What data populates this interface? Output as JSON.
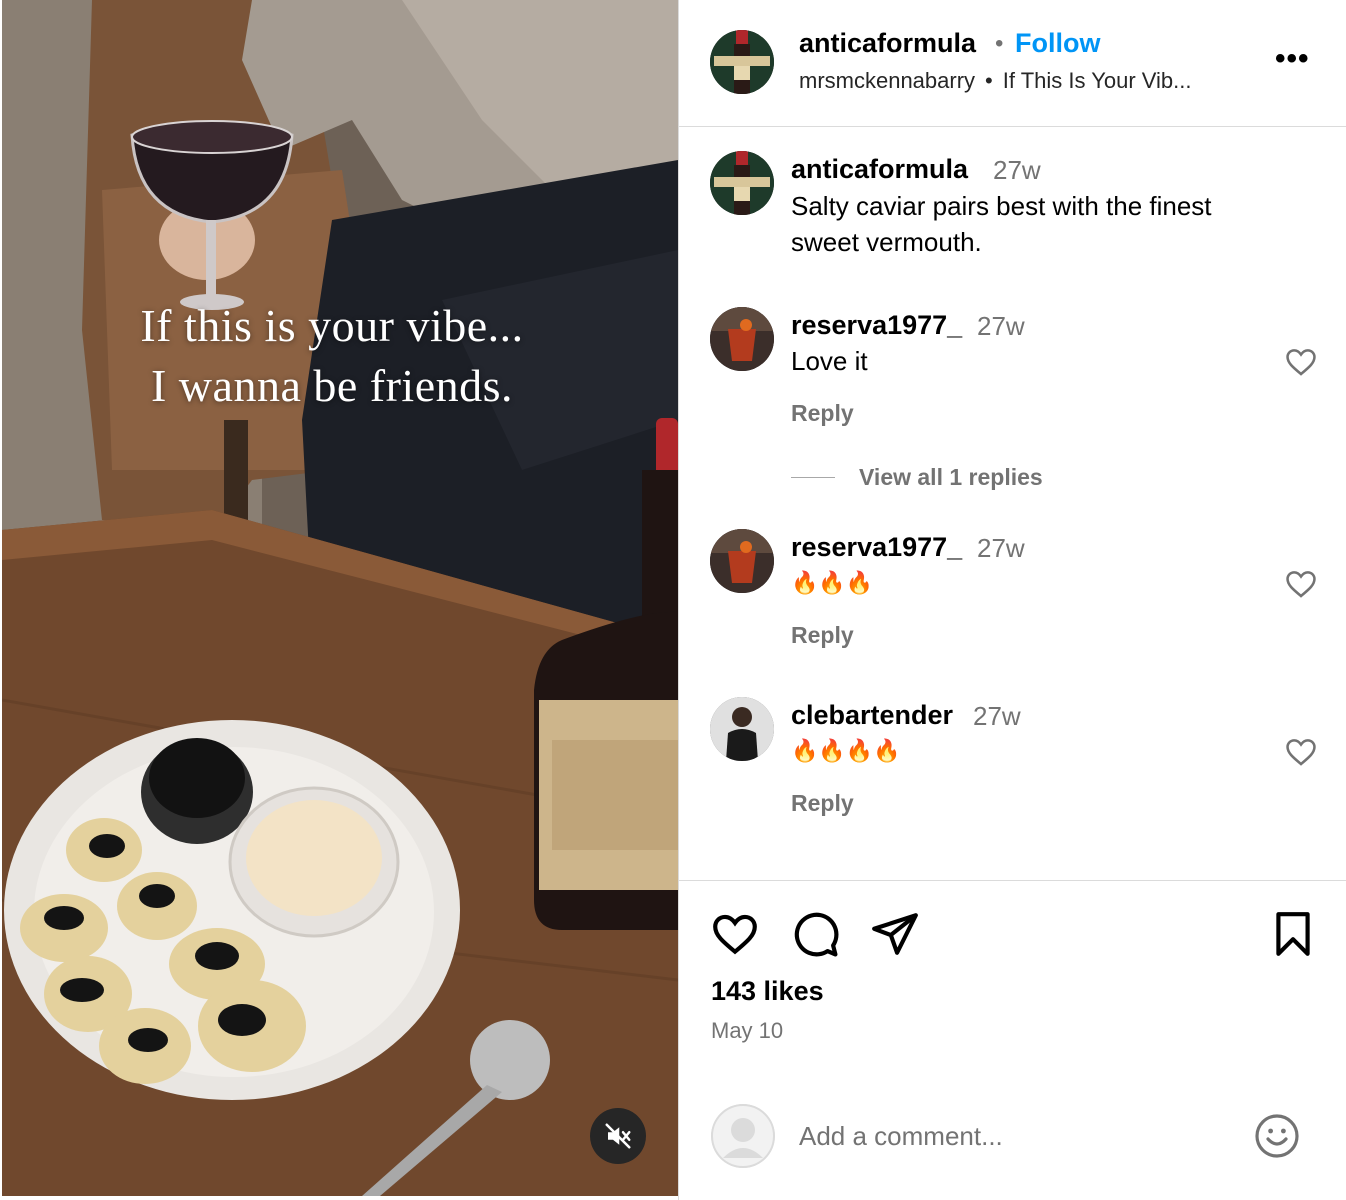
{
  "media": {
    "overlay_line_1": "If this is your vibe...",
    "overlay_line_2": "I wanna be friends.",
    "mute_icon": "speaker-muted-icon"
  },
  "header": {
    "username": "anticaformula",
    "separator": "•",
    "follow_label": "Follow",
    "audio_user": "mrsmckennabarry",
    "audio_dot": "•",
    "audio_title": "If This Is Your Vib...",
    "more_label": "•••"
  },
  "caption": {
    "username": "anticaformula",
    "time": "27w",
    "text_line_1": "Salty caviar pairs best with the finest",
    "text_line_2": "sweet vermouth."
  },
  "comments": [
    {
      "username": "reserva1977_",
      "time": "27w",
      "text": "Love it",
      "reply_label": "Reply",
      "view_replies": "View all 1 replies"
    },
    {
      "username": "reserva1977_",
      "time": "27w",
      "text": "🔥🔥🔥",
      "reply_label": "Reply"
    },
    {
      "username": "clebartender",
      "time": "27w",
      "text": "🔥🔥🔥🔥",
      "reply_label": "Reply"
    }
  ],
  "actions": {
    "like_icon": "heart-icon",
    "comment_icon": "comment-bubble-icon",
    "share_icon": "paper-plane-icon",
    "save_icon": "bookmark-icon",
    "likes_text": "143 likes",
    "date_text": "May 10"
  },
  "add_comment": {
    "placeholder": "Add a comment...",
    "emoji_icon": "smiley-icon"
  },
  "colors": {
    "follow_blue": "#0095f6",
    "secondary_text": "#737373",
    "divider": "#dbdbdb"
  }
}
